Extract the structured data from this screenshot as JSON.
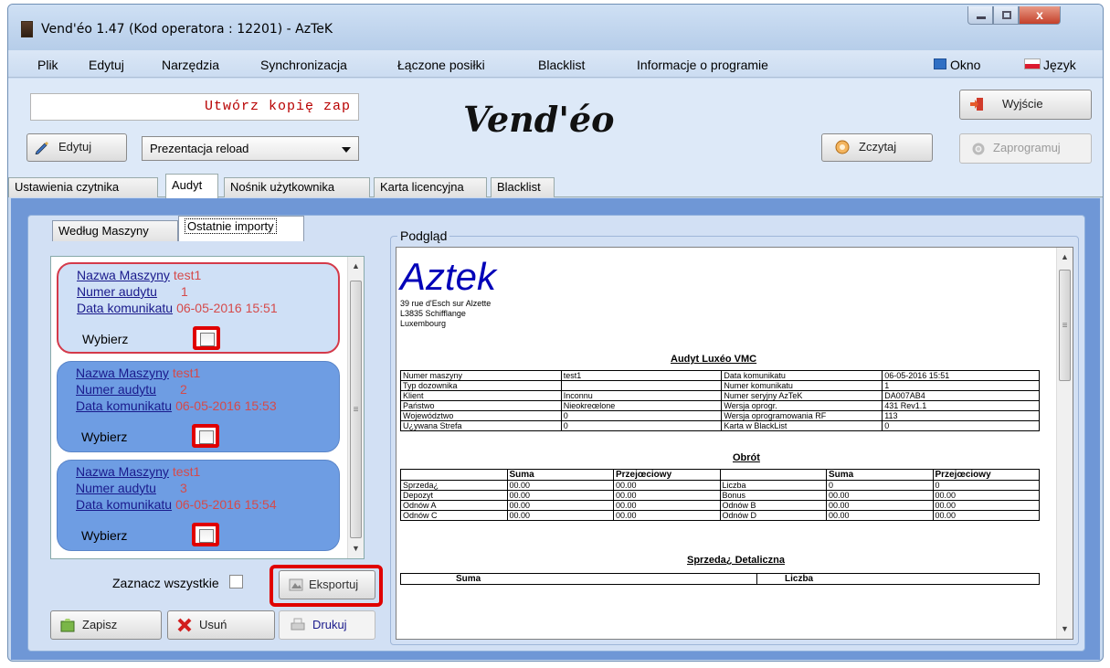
{
  "window": {
    "title": "Vend'éo 1.47 (Kod operatora : 12201) - AzTeK",
    "close_glyph": "x"
  },
  "menu": {
    "items": [
      "Plik",
      "Edytuj",
      "Narzędzia",
      "Synchronizacja",
      "Łączone posiłki",
      "Blacklist",
      "Informacje o programie"
    ],
    "okno": "Okno",
    "jezyk": "Język"
  },
  "toolbar": {
    "backup_text": "Utwórz kopię zap",
    "logo": "Vend'éo",
    "edytuj": "Edytuj",
    "preset": "Prezentacja reload",
    "zczytaj": "Zczytaj",
    "wyjscie": "Wyjście",
    "zaprogramuj": "Zaprogramuj"
  },
  "tabs": [
    "Ustawienia czytnika",
    "Audyt",
    "Nośnik użytkownika",
    "Karta licencyjna",
    "Blacklist"
  ],
  "audit": {
    "subtabs": [
      "Według Maszyny",
      "Ostatnie importy"
    ],
    "labels": {
      "machine": "Nazwa Maszyny",
      "audit_no": "Numer audytu",
      "date": "Data komunikatu",
      "choose": "Wybierz"
    },
    "items": [
      {
        "machine": "test1",
        "audit_no": "1",
        "date": "06-05-2016 15:51"
      },
      {
        "machine": "test1",
        "audit_no": "2",
        "date": "06-05-2016 15:53"
      },
      {
        "machine": "test1",
        "audit_no": "3",
        "date": "06-05-2016 15:54"
      }
    ],
    "select_all": "Zaznacz wszystkie",
    "export": "Eksportuj",
    "save": "Zapisz",
    "delete": "Usuń",
    "print": "Drukuj"
  },
  "preview": {
    "label": "Podgląd",
    "company": "Aztek",
    "address": [
      "39 rue d'Esch sur Alzette",
      "L3835 Schifflange",
      "Luxembourg"
    ],
    "report_title": "Audyt Luxéo VMC",
    "info_rows": [
      [
        "Numer maszyny",
        "test1",
        "Data komunikatu",
        "06-05-2016 15:51"
      ],
      [
        "Typ dozownika",
        "",
        "Numer komunikatu",
        "1"
      ],
      [
        "Klient",
        "Inconnu",
        "Numer seryjny AzTeK",
        "DA007AB4"
      ],
      [
        "Państwo",
        "Nieokreœlone",
        "Wersja oprogr.",
        "431 Rev1.1"
      ],
      [
        "Województwo",
        "0",
        "Wersja oprogramowania RF",
        "113"
      ],
      [
        "U¿ywana Strefa",
        "0",
        "Karta w BlackList",
        "0"
      ]
    ],
    "obrot_title": "Obrót",
    "obrot_headers": [
      "",
      "Suma",
      "Przejœciowy",
      "",
      "Suma",
      "Przejœciowy"
    ],
    "obrot_rows": [
      [
        "Sprzeda¿",
        "00.00",
        "00.00",
        "Liczba",
        "0",
        "0"
      ],
      [
        "Depozyt",
        "00.00",
        "00.00",
        "Bonus",
        "00.00",
        "00.00"
      ],
      [
        "Odnów A",
        "00.00",
        "00.00",
        "Odnów B",
        "00.00",
        "00.00"
      ],
      [
        "Odnów C",
        "00.00",
        "00.00",
        "Odnów D",
        "00.00",
        "00.00"
      ]
    ],
    "retail_title": "Sprzeda¿ Detaliczna",
    "retail_headers": [
      "Suma",
      "Liczba"
    ]
  }
}
